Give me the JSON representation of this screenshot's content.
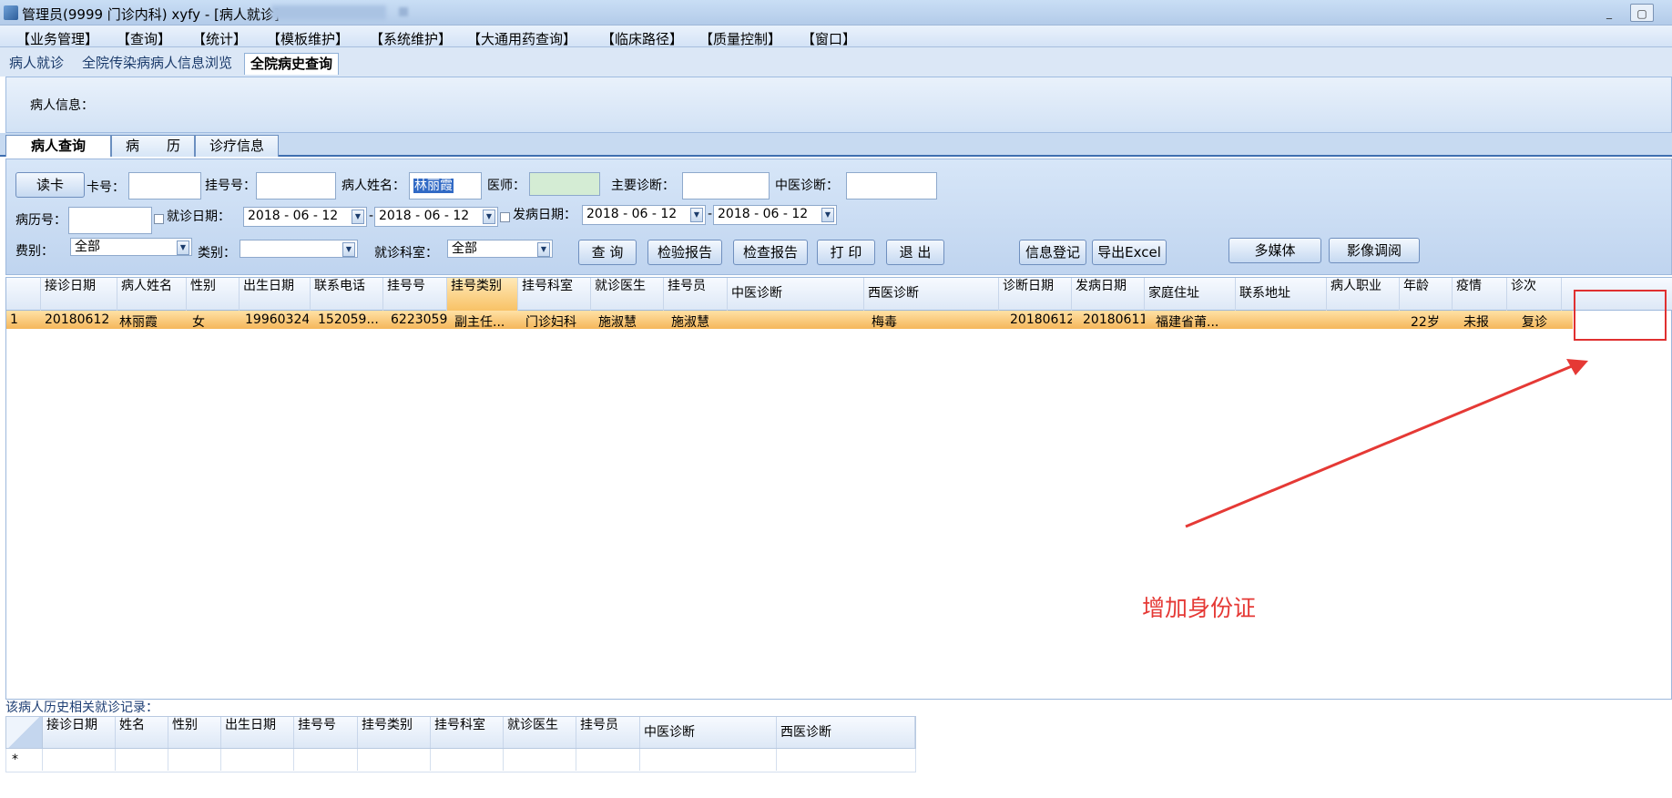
{
  "window": {
    "title": "管理员(9999 门诊内科) xyfy - [病人就诊]",
    "max_glyph": "▢",
    "min_glyph": "_"
  },
  "menu": [
    "【业务管理】",
    "【查询】",
    "【统计】",
    "【模板维护】",
    "【系统维护】",
    "【大通用药查询】",
    "【临床路径】",
    "【质量控制】",
    "【窗口】"
  ],
  "top_tabs": [
    "病人就诊",
    "全院传染病病人信息浏览",
    "全院病史查询"
  ],
  "active_top_tab": "全院病史查询",
  "patient_info_label": "病人信息：",
  "sub_tabs": [
    "病人查询",
    "病　　历",
    "诊疗信息"
  ],
  "form": {
    "read_card_btn": "读卡",
    "card_no_label": "卡号：",
    "reg_no_label": "挂号号：",
    "patient_name_label": "病人姓名：",
    "patient_name_value": "林丽霞",
    "doctor_label": "医师：",
    "main_diag_label": "主要诊断：",
    "tcm_diag_label": "中医诊断：",
    "record_no_label": "病历号：",
    "visit_date_label": "就诊日期：",
    "visit_date_from": "2018 - 06 - 12",
    "visit_date_to": "2018 - 06 - 12",
    "dash": "-",
    "onset_date_label": "发病日期：",
    "onset_date_from": "2018 - 06 - 12",
    "onset_date_to": "2018 - 06 - 12",
    "fee_type_label": "费别：",
    "fee_type_value": "全部",
    "category_label": "类别：",
    "category_value": "",
    "dept_label": "就诊科室：",
    "dept_value": "全部",
    "buttons": {
      "query": "查 询",
      "lab_report": "检验报告",
      "exam_report": "检查报告",
      "print": "打 印",
      "exit": "退 出",
      "info_register": "信息登记",
      "export_excel": "导出Excel",
      "multimedia": "多媒体",
      "imaging": "影像调阅"
    },
    "dropdown_glyph": "▼"
  },
  "grid": {
    "columns": [
      "接诊日期",
      "病人姓名",
      "性别",
      "出生日期",
      "联系电话",
      "挂号号",
      "挂号类别",
      "挂号科室",
      "就诊医生",
      "挂号员",
      "中医诊断",
      "西医诊断",
      "诊断日期",
      "发病日期",
      "家庭住址",
      "联系地址",
      "病人职业",
      "年龄",
      "疫情",
      "诊次"
    ],
    "rows": [
      [
        "1",
        "20180612",
        "林丽霞",
        "女",
        "19960324",
        "152059...",
        "6223059",
        "副主任...",
        "门诊妇科",
        "施淑慧",
        "施淑慧",
        "",
        "梅毒",
        "20180612",
        "20180611",
        "福建省莆...",
        "",
        "",
        "22岁",
        "未报",
        "复诊"
      ]
    ]
  },
  "annotation": {
    "text": "增加身份证",
    "color": "#e53935"
  },
  "history": {
    "label": "该病人历史相关就诊记录：",
    "columns": [
      "接诊日期",
      "姓名",
      "性别",
      "出生日期",
      "挂号号",
      "挂号类别",
      "挂号科室",
      "就诊医生",
      "挂号员",
      "中医诊断",
      "西医诊断"
    ],
    "new_row_marker": "*"
  }
}
